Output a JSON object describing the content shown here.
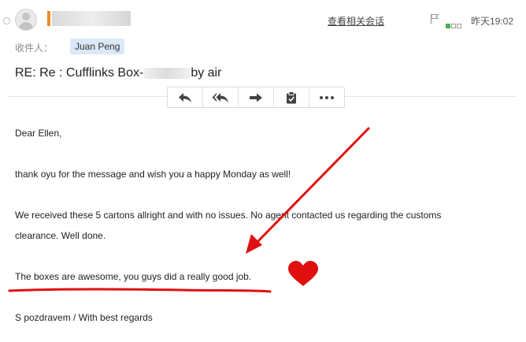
{
  "header": {
    "related_link": "查看相关会话",
    "timestamp": "昨天19:02"
  },
  "recipient": {
    "label": "收件人：",
    "name": "Juan Peng"
  },
  "subject": {
    "prefix": "RE: Re : Cufflinks Box-",
    "suffix": "by air"
  },
  "toolbar": {
    "icons": [
      "reply-icon",
      "reply-all-icon",
      "forward-icon",
      "clipboard-icon",
      "more-icon"
    ]
  },
  "body": {
    "greeting": "Dear Ellen,",
    "line1": "thank oyu for the message and wish you a happy Monday as well!",
    "line2": "We received these 5 cartons allright and with no issues. No agent contacted us regarding the customs",
    "line2b": "clearance. Well done.",
    "line3": "The boxes are awesome, you guys did a really good job.",
    "signoff": "S pozdravem / With best regards"
  },
  "colors": {
    "sender_flag": "#f08a24",
    "recipient_chip": "#dbe8f7",
    "annotation_red": "#e01010",
    "priority_green": "#4caf50"
  }
}
